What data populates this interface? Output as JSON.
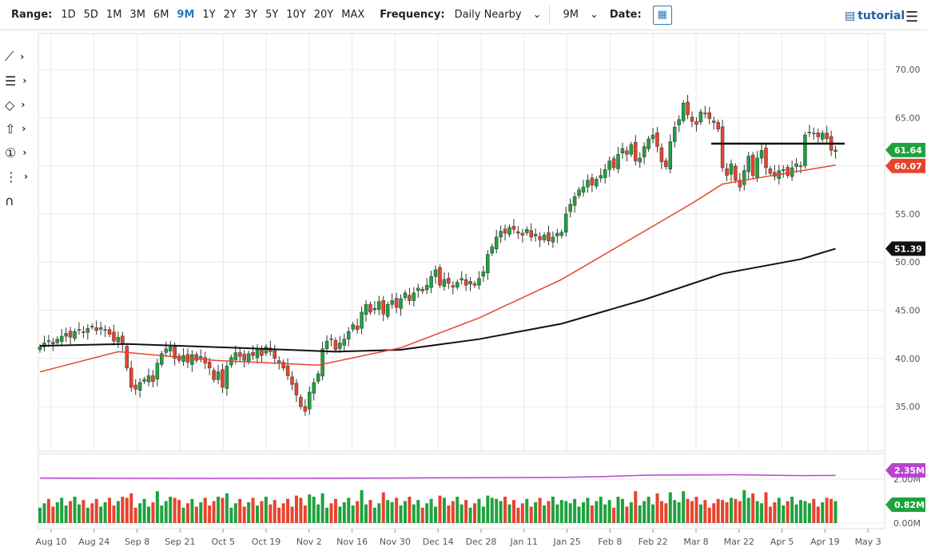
{
  "toolbar": {
    "range_label": "Range:",
    "ranges": [
      "1D",
      "5D",
      "1M",
      "3M",
      "6M",
      "9M",
      "1Y",
      "2Y",
      "3Y",
      "5Y",
      "10Y",
      "20Y",
      "MAX"
    ],
    "active_range": "9M",
    "frequency_label": "Frequency:",
    "frequency_value": "Daily Nearby",
    "period_value": "9M",
    "date_label": "Date:",
    "tutorial_label": "tutorial"
  },
  "drawing_tools": [
    "line-tool",
    "fib-tool",
    "shape-tool",
    "arrow-tool",
    "number-tool",
    "measure-tool",
    "magnet-tool"
  ],
  "colors": {
    "up": "#1fa23e",
    "down": "#e8432d",
    "ma50": "#e8432d",
    "ma200": "#111111",
    "vol_ma": "#b845d0",
    "grid": "#e8e8e8"
  },
  "chart_data": {
    "type": "candlestick",
    "x_ticks": [
      "Aug 10",
      "Aug 24",
      "Sep 8",
      "Sep 21",
      "Oct 5",
      "Oct 19",
      "Nov 2",
      "Nov 16",
      "Nov 30",
      "Dec 14",
      "Dec 28",
      "Jan 11",
      "Jan 25",
      "Feb 8",
      "Feb 22",
      "Mar 8",
      "Mar 22",
      "Apr 5",
      "Apr 19",
      "May 3"
    ],
    "y_ticks": [
      "70.00",
      "65.00",
      "60.00",
      "55.00",
      "50.00",
      "45.00",
      "40.00",
      "35.00"
    ],
    "ylim": [
      32,
      73
    ],
    "closes": [
      41.2,
      41.6,
      41.8,
      41.5,
      42.0,
      42.3,
      42.6,
      42.2,
      42.8,
      43.0,
      42.7,
      43.1,
      43.3,
      42.9,
      43.2,
      43.0,
      42.5,
      41.8,
      42.2,
      41.5,
      39.0,
      37.0,
      36.8,
      37.5,
      37.8,
      38.2,
      37.6,
      39.5,
      40.5,
      41.0,
      41.2,
      40.0,
      39.8,
      40.3,
      39.6,
      40.4,
      39.8,
      40.2,
      39.5,
      39.0,
      37.8,
      38.6,
      37.0,
      39.2,
      40.1,
      40.6,
      40.2,
      39.8,
      40.5,
      40.3,
      40.9,
      40.3,
      41.2,
      40.7,
      40.0,
      39.6,
      39.0,
      38.2,
      37.3,
      36.2,
      35.0,
      34.5,
      36.5,
      37.5,
      38.4,
      41.0,
      41.8,
      42.0,
      40.9,
      41.6,
      42.0,
      42.8,
      43.5,
      43.0,
      44.8,
      45.6,
      44.8,
      45.2,
      45.9,
      44.6,
      45.6,
      46.0,
      45.3,
      46.2,
      46.8,
      46.0,
      46.8,
      47.3,
      47.0,
      47.6,
      48.5,
      49.2,
      47.6,
      48.2,
      47.8,
      47.4,
      47.9,
      48.3,
      47.6,
      48.0,
      47.6,
      48.3,
      49.0,
      50.8,
      51.6,
      52.6,
      53.2,
      53.0,
      53.6,
      53.4,
      53.0,
      52.8,
      53.4,
      52.6,
      52.9,
      52.3,
      52.8,
      52.2,
      52.6,
      53.0,
      53.1,
      55.0,
      56.0,
      56.8,
      57.5,
      57.8,
      58.5,
      58.0,
      58.6,
      59.0,
      59.6,
      60.5,
      59.8,
      61.2,
      61.8,
      61.2,
      62.2,
      60.5,
      60.8,
      62.0,
      62.8,
      63.2,
      62.0,
      60.4,
      59.9,
      62.5,
      64.0,
      64.8,
      66.5,
      65.3,
      64.6,
      64.3,
      65.6,
      65.4,
      64.9,
      64.5,
      63.8,
      59.8,
      59.0,
      60.2,
      58.5,
      57.8,
      59.5,
      61.0,
      59.0,
      60.8,
      61.6,
      59.8,
      59.2,
      58.9,
      59.5,
      59.6,
      59.0,
      59.8,
      60.2,
      60.0,
      63.2,
      63.5,
      63.3,
      63.0,
      63.4,
      62.8,
      61.6,
      61.64
    ],
    "ma50": [
      [
        0,
        38.6
      ],
      [
        18,
        40.7
      ],
      [
        40,
        39.8
      ],
      [
        64,
        39.3
      ],
      [
        83,
        41.1
      ],
      [
        101,
        44.2
      ],
      [
        120,
        48.2
      ],
      [
        139,
        53.2
      ],
      [
        150,
        56.1
      ],
      [
        157,
        58.1
      ],
      [
        166,
        58.8
      ],
      [
        183,
        60.07
      ]
    ],
    "ma200": [
      [
        0,
        41.3
      ],
      [
        20,
        41.5
      ],
      [
        45,
        41.1
      ],
      [
        68,
        40.7
      ],
      [
        83,
        40.9
      ],
      [
        101,
        42.0
      ],
      [
        120,
        43.6
      ],
      [
        139,
        46.1
      ],
      [
        157,
        48.8
      ],
      [
        175,
        50.3
      ],
      [
        183,
        51.39
      ]
    ],
    "resistance_level": 62.3,
    "last_price": "61.64",
    "ma50_label": "60.07",
    "ma200_label": "51.39",
    "volume": {
      "y_ticks": [
        "2.00M",
        "0.00M"
      ],
      "ylim": [
        0,
        2.4
      ],
      "last_volume": "0.82M",
      "vol_ma_label": "2.35M",
      "vol_ma": [
        [
          0,
          2.05
        ],
        [
          40,
          2.03
        ],
        [
          80,
          2.05
        ],
        [
          120,
          2.08
        ],
        [
          130,
          2.12
        ],
        [
          140,
          2.18
        ],
        [
          160,
          2.2
        ],
        [
          175,
          2.16
        ],
        [
          183,
          2.17
        ]
      ]
    }
  }
}
